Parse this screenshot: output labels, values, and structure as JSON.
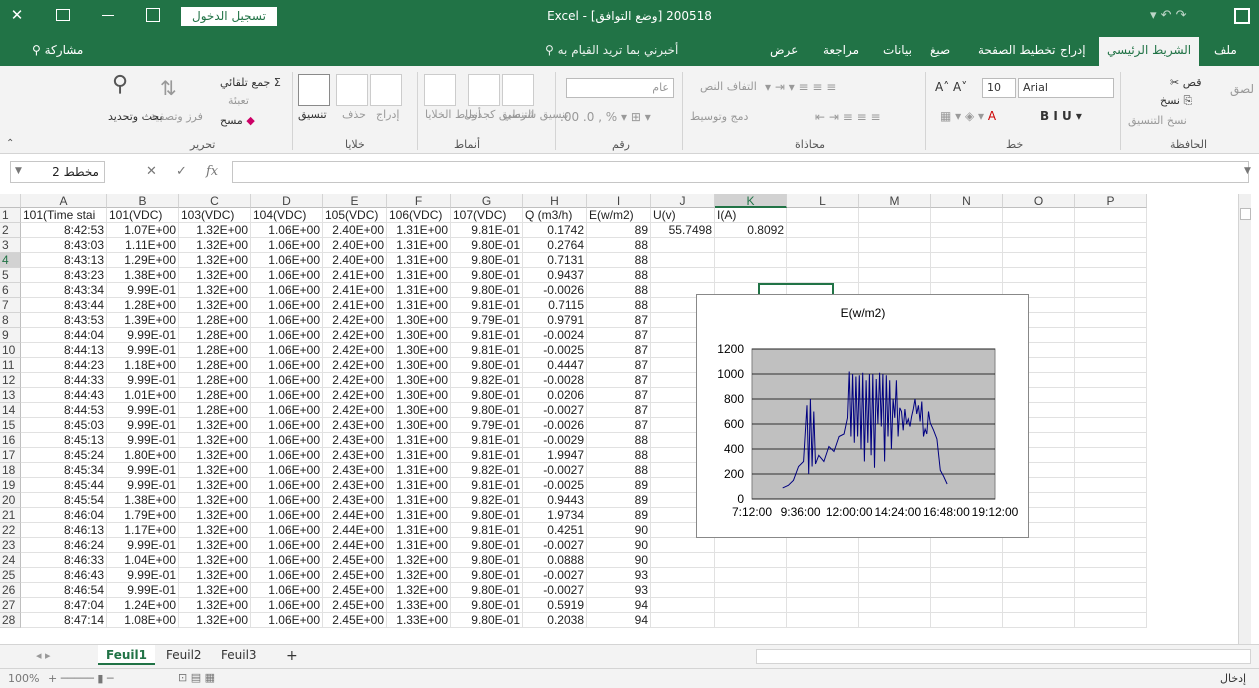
{
  "window": {
    "title": "Excel - [وضع التوافق] 200518",
    "signin": "تسجيل الدخول"
  },
  "tabs": {
    "file": "ملف",
    "home": "الشريط الرئيسي",
    "insert": "إدراج",
    "page_layout": "تخطيط الصفحة",
    "formulas": "صيغ",
    "data": "بيانات",
    "review": "مراجعة",
    "view": "عرض",
    "tell_me": "أخبرني بما تريد القيام به",
    "share": "مشاركة"
  },
  "ribbon": {
    "clipboard": {
      "label": "الحافظة",
      "paste": "لصق",
      "cut": "قص",
      "copy": "نسخ",
      "format_painter": "نسخ التنسيق"
    },
    "font": {
      "label": "خط",
      "font_name": "Arial",
      "font_size": "10"
    },
    "alignment": {
      "label": "محاذاة",
      "wrap": "التفاف النص",
      "merge": "دمج وتوسيط"
    },
    "number": {
      "label": "رقم",
      "format": "عام"
    },
    "styles": {
      "label": "أنماط",
      "conditional": "تنسيق شرطي",
      "as_table": "التنسيق كجدول",
      "cell_styles": "أنماط الخلايا"
    },
    "cells": {
      "label": "خلايا",
      "insert": "إدراج",
      "delete": "حذف",
      "format": "تنسيق"
    },
    "editing": {
      "label": "تحرير",
      "autosum": "جمع تلقائي",
      "fill": "تعبئة",
      "clear": "مسح",
      "sort": "فرز وتصفية",
      "find": "بحث وتحديد"
    }
  },
  "formula_bar": {
    "name_box": "مخطط 2",
    "cancel": "✕",
    "enter": "✓",
    "fx": "fx",
    "value": ""
  },
  "columns": [
    "A",
    "B",
    "C",
    "D",
    "E",
    "F",
    "G",
    "H",
    "I",
    "J",
    "K",
    "L",
    "M",
    "N",
    "O",
    "P"
  ],
  "rows": [
    [
      "1",
      "101(Time stai",
      "101(VDC)",
      "103(VDC)",
      "104(VDC)",
      "105(VDC)",
      "106(VDC)",
      "107(VDC)",
      "Q (m3/h)",
      "E(w/m2)",
      "U(v)",
      "I(A)"
    ],
    [
      "2",
      "8:42:53",
      "1.07E+00",
      "1.32E+00",
      "1.06E+00",
      "2.40E+00",
      "1.31E+00",
      "9.81E-01",
      "0.1742",
      "89",
      "55.7498",
      "0.8092"
    ],
    [
      "3",
      "8:43:03",
      "1.11E+00",
      "1.32E+00",
      "1.06E+00",
      "2.40E+00",
      "1.31E+00",
      "9.80E-01",
      "0.2764",
      "88",
      "",
      ""
    ],
    [
      "4",
      "8:43:13",
      "1.29E+00",
      "1.32E+00",
      "1.06E+00",
      "2.40E+00",
      "1.31E+00",
      "9.80E-01",
      "0.7131",
      "88",
      "",
      ""
    ],
    [
      "5",
      "8:43:23",
      "1.38E+00",
      "1.32E+00",
      "1.06E+00",
      "2.41E+00",
      "1.31E+00",
      "9.80E-01",
      "0.9437",
      "88",
      "",
      ""
    ],
    [
      "6",
      "8:43:34",
      "9.99E-01",
      "1.32E+00",
      "1.06E+00",
      "2.41E+00",
      "1.31E+00",
      "9.80E-01",
      "-0.0026",
      "88",
      "",
      ""
    ],
    [
      "7",
      "8:43:44",
      "1.28E+00",
      "1.32E+00",
      "1.06E+00",
      "2.41E+00",
      "1.31E+00",
      "9.81E-01",
      "0.7115",
      "88",
      "",
      ""
    ],
    [
      "8",
      "8:43:53",
      "1.39E+00",
      "1.28E+00",
      "1.06E+00",
      "2.42E+00",
      "1.30E+00",
      "9.79E-01",
      "0.9791",
      "87",
      "",
      ""
    ],
    [
      "9",
      "8:44:04",
      "9.99E-01",
      "1.28E+00",
      "1.06E+00",
      "2.42E+00",
      "1.30E+00",
      "9.81E-01",
      "-0.0024",
      "87",
      "",
      ""
    ],
    [
      "10",
      "8:44:13",
      "9.99E-01",
      "1.28E+00",
      "1.06E+00",
      "2.42E+00",
      "1.30E+00",
      "9.81E-01",
      "-0.0025",
      "87",
      "",
      ""
    ],
    [
      "11",
      "8:44:23",
      "1.18E+00",
      "1.28E+00",
      "1.06E+00",
      "2.42E+00",
      "1.30E+00",
      "9.80E-01",
      "0.4447",
      "87",
      "",
      ""
    ],
    [
      "12",
      "8:44:33",
      "9.99E-01",
      "1.28E+00",
      "1.06E+00",
      "2.42E+00",
      "1.30E+00",
      "9.82E-01",
      "-0.0028",
      "87",
      "",
      ""
    ],
    [
      "13",
      "8:44:43",
      "1.01E+00",
      "1.28E+00",
      "1.06E+00",
      "2.42E+00",
      "1.30E+00",
      "9.80E-01",
      "0.0206",
      "87",
      "",
      ""
    ],
    [
      "14",
      "8:44:53",
      "9.99E-01",
      "1.28E+00",
      "1.06E+00",
      "2.42E+00",
      "1.30E+00",
      "9.80E-01",
      "-0.0027",
      "87",
      "",
      ""
    ],
    [
      "15",
      "8:45:03",
      "9.99E-01",
      "1.32E+00",
      "1.06E+00",
      "2.43E+00",
      "1.30E+00",
      "9.79E-01",
      "-0.0026",
      "87",
      "",
      ""
    ],
    [
      "16",
      "8:45:13",
      "9.99E-01",
      "1.32E+00",
      "1.06E+00",
      "2.43E+00",
      "1.31E+00",
      "9.81E-01",
      "-0.0029",
      "88",
      "",
      ""
    ],
    [
      "17",
      "8:45:24",
      "1.80E+00",
      "1.32E+00",
      "1.06E+00",
      "2.43E+00",
      "1.31E+00",
      "9.81E-01",
      "1.9947",
      "88",
      "",
      ""
    ],
    [
      "18",
      "8:45:34",
      "9.99E-01",
      "1.32E+00",
      "1.06E+00",
      "2.43E+00",
      "1.31E+00",
      "9.82E-01",
      "-0.0027",
      "88",
      "",
      ""
    ],
    [
      "19",
      "8:45:44",
      "9.99E-01",
      "1.32E+00",
      "1.06E+00",
      "2.43E+00",
      "1.31E+00",
      "9.81E-01",
      "-0.0025",
      "89",
      "",
      ""
    ],
    [
      "20",
      "8:45:54",
      "1.38E+00",
      "1.32E+00",
      "1.06E+00",
      "2.43E+00",
      "1.31E+00",
      "9.82E-01",
      "0.9443",
      "89",
      "",
      ""
    ],
    [
      "21",
      "8:46:04",
      "1.79E+00",
      "1.32E+00",
      "1.06E+00",
      "2.44E+00",
      "1.31E+00",
      "9.80E-01",
      "1.9734",
      "89",
      "",
      ""
    ],
    [
      "22",
      "8:46:13",
      "1.17E+00",
      "1.32E+00",
      "1.06E+00",
      "2.44E+00",
      "1.31E+00",
      "9.81E-01",
      "0.4251",
      "90",
      "",
      ""
    ],
    [
      "23",
      "8:46:24",
      "9.99E-01",
      "1.32E+00",
      "1.06E+00",
      "2.44E+00",
      "1.31E+00",
      "9.80E-01",
      "-0.0027",
      "90",
      "",
      ""
    ],
    [
      "24",
      "8:46:33",
      "1.04E+00",
      "1.32E+00",
      "1.06E+00",
      "2.45E+00",
      "1.32E+00",
      "9.80E-01",
      "0.0888",
      "90",
      "",
      ""
    ],
    [
      "25",
      "8:46:43",
      "9.99E-01",
      "1.32E+00",
      "1.06E+00",
      "2.45E+00",
      "1.32E+00",
      "9.80E-01",
      "-0.0027",
      "93",
      "",
      ""
    ],
    [
      "26",
      "8:46:54",
      "9.99E-01",
      "1.32E+00",
      "1.06E+00",
      "2.45E+00",
      "1.32E+00",
      "9.80E-01",
      "-0.0027",
      "93",
      "",
      ""
    ],
    [
      "27",
      "8:47:04",
      "1.24E+00",
      "1.32E+00",
      "1.06E+00",
      "2.45E+00",
      "1.33E+00",
      "9.80E-01",
      "0.5919",
      "94",
      "",
      ""
    ],
    [
      "28",
      "8:47:14",
      "1.08E+00",
      "1.32E+00",
      "1.06E+00",
      "2.45E+00",
      "1.33E+00",
      "9.80E-01",
      "0.2038",
      "94",
      "",
      ""
    ]
  ],
  "chart_data": {
    "type": "line",
    "title": "E(w/m2)",
    "xlabel": "",
    "ylabel": "",
    "x_ticks": [
      "7:12:00",
      "9:36:00",
      "12:00:00",
      "14:24:00",
      "16:48:00",
      "19:12:00"
    ],
    "y_ticks": [
      "0",
      "200",
      "400",
      "600",
      "800",
      "1000",
      "1200"
    ],
    "xlim": [
      "7:12:00",
      "19:12:00"
    ],
    "ylim": [
      0,
      1200
    ],
    "grid": true,
    "legend": "none",
    "plot_bg": "#c0c0c0",
    "line_color": "#000080",
    "series": [
      {
        "x": [
          "8:43",
          "9:00",
          "9:15",
          "9:30",
          "9:45",
          "9:55",
          "10:00",
          "10:05",
          "10:10",
          "10:15",
          "10:20",
          "10:30",
          "10:45",
          "11:00",
          "11:15",
          "11:30",
          "11:45",
          "11:55",
          "12:00",
          "12:05",
          "12:10",
          "12:15",
          "12:20",
          "12:25",
          "12:30",
          "12:35",
          "12:40",
          "12:45",
          "12:50",
          "12:55",
          "13:00",
          "13:05",
          "13:10",
          "13:15",
          "13:20",
          "13:25",
          "13:30",
          "13:35",
          "13:40",
          "13:45",
          "13:50",
          "13:55",
          "14:00",
          "14:05",
          "14:10",
          "14:15",
          "14:20",
          "14:25",
          "14:30",
          "14:35",
          "14:40",
          "14:45",
          "14:50",
          "14:55",
          "15:00",
          "15:05",
          "15:10",
          "15:15",
          "15:20",
          "15:25",
          "15:30",
          "15:35",
          "15:40",
          "15:45",
          "15:50",
          "15:55",
          "16:00",
          "16:10",
          "16:20",
          "16:30",
          "16:40",
          "16:50"
        ],
        "values": [
          89,
          110,
          150,
          260,
          300,
          750,
          200,
          800,
          260,
          700,
          280,
          350,
          300,
          420,
          380,
          500,
          520,
          650,
          1020,
          500,
          1000,
          450,
          980,
          500,
          990,
          400,
          1010,
          300,
          950,
          450,
          1000,
          350,
          1000,
          250,
          960,
          600,
          1010,
          580,
          1000,
          300,
          990,
          500,
          950,
          400,
          800,
          650,
          950,
          500,
          730,
          700,
          550,
          720,
          600,
          640,
          580,
          660,
          720,
          800,
          680,
          750,
          620,
          780,
          500,
          560,
          520,
          700,
          610,
          550,
          480,
          230,
          180,
          120
        ]
      }
    ]
  },
  "sheets": {
    "active": "Feuil1",
    "tabs": [
      "Feuil1",
      "Feuil2",
      "Feuil3"
    ],
    "add": "+"
  },
  "status": {
    "mode": "إدخال",
    "zoom": "100%"
  }
}
